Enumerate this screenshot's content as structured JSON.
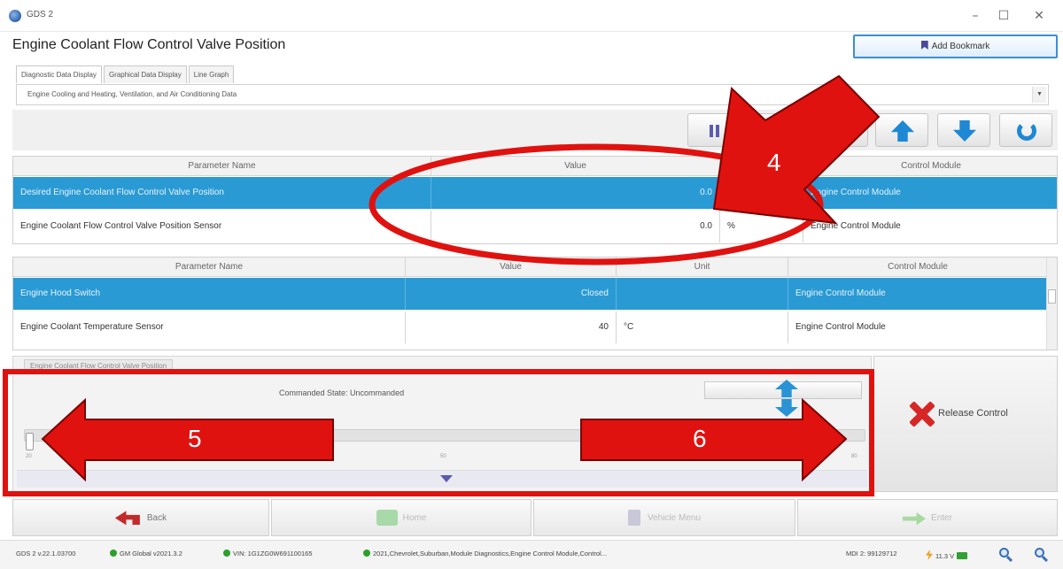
{
  "window": {
    "app_name": "GDS 2",
    "minimize": "–",
    "maximize": "☐",
    "close": "✕"
  },
  "header": {
    "title": "Engine Coolant Flow Control Valve Position",
    "bookmark_label": "Add Bookmark"
  },
  "tabs": [
    {
      "label": "Diagnostic Data Display",
      "active": true
    },
    {
      "label": "Graphical Data Display",
      "active": false
    },
    {
      "label": "Line Graph",
      "active": false
    }
  ],
  "data_list": {
    "selected": "Engine Cooling and Heating, Ventilation, and Air Conditioning Data"
  },
  "toolbar": {
    "buttons": [
      "pause-icon",
      "up-arrow-icon",
      "down-arrow-icon",
      "refresh-icon"
    ]
  },
  "table1": {
    "headers": [
      "Parameter Name",
      "Value",
      "",
      "Control Module"
    ],
    "rows": [
      {
        "name": "Desired Engine Coolant Flow Control Valve Position",
        "value": "0.0",
        "unit": "",
        "module": "Engine Control Module",
        "selected": true
      },
      {
        "name": "Engine Coolant Flow Control Valve Position Sensor",
        "value": "0.0",
        "unit": "%",
        "module": "Engine Control Module",
        "selected": false
      }
    ]
  },
  "table2": {
    "headers": [
      "Parameter Name",
      "Value",
      "Unit",
      "Control Module"
    ],
    "rows": [
      {
        "name": "Engine Hood Switch",
        "value": "Closed",
        "unit": "",
        "module": "Engine Control Module",
        "selected": true
      },
      {
        "name": "Engine Coolant Temperature Sensor",
        "value": "40",
        "unit": "°C",
        "module": "Engine Control Module",
        "selected": false
      }
    ]
  },
  "control": {
    "tab_label": "Engine Coolant Flow Control Valve Position",
    "commanded_state": "Commanded State: Uncommanded",
    "slider_min": "20",
    "slider_mid": "50",
    "slider_max": "80",
    "slider_fraction": 0.0,
    "release_label": "Release Control"
  },
  "nav": {
    "back": "Back",
    "home": "Home",
    "vehicle_menu": "Vehicle Menu",
    "enter": "Enter"
  },
  "status": {
    "version": "GDS 2 v.22.1.03700",
    "global": "GM Global v2021.3.2",
    "vin": "VIN: 1G1ZG0W691100165",
    "path": "2021,Chevrolet,Suburban,Module Diagnostics,Engine Control Module,Control...",
    "mdi": "MDI 2: 99129712",
    "voltage": "11.3 V"
  },
  "annotations": {
    "arrow_4": "4",
    "arrow_5": "5",
    "arrow_6": "6",
    "color": "#e0120f"
  },
  "colors": {
    "selection": "#2a9ad4",
    "accent": "#1e88d4",
    "annotation": "#e0120f"
  }
}
